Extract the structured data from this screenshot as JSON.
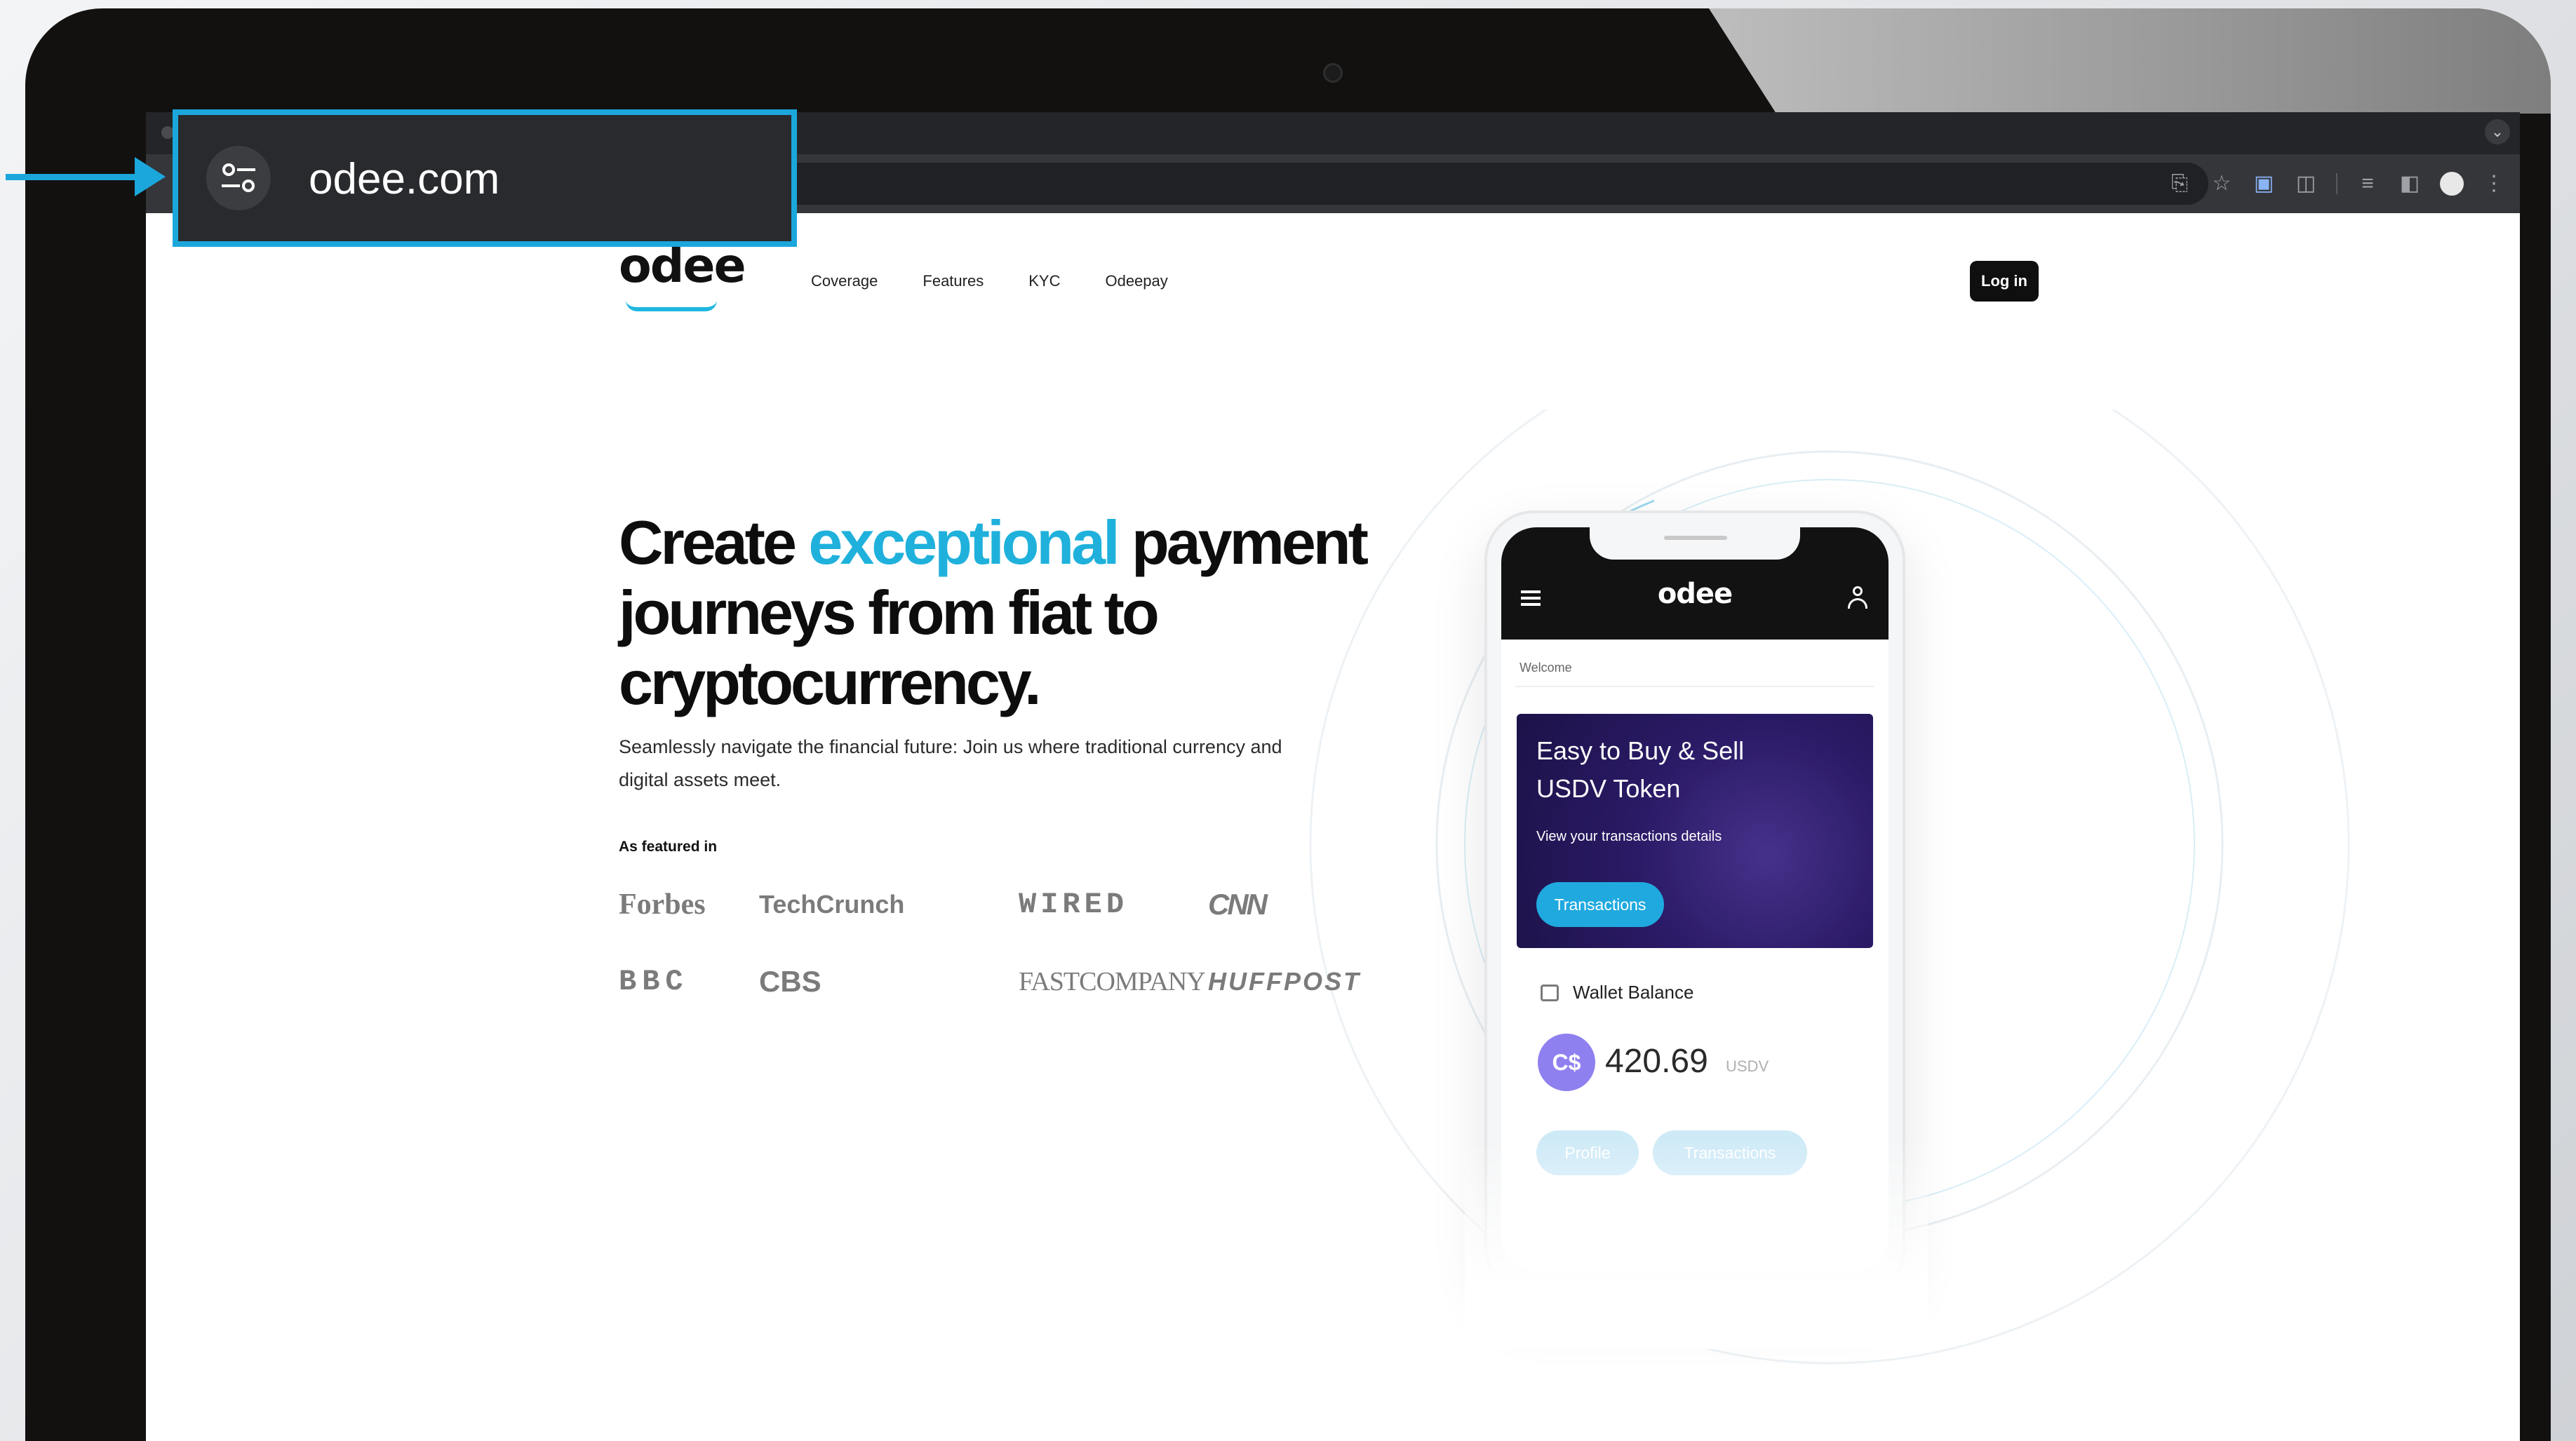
{
  "browser": {
    "url": "odee.com"
  },
  "site": {
    "logo": "odee",
    "nav": [
      "Coverage",
      "Features",
      "KYC",
      "Odeepay"
    ],
    "login_label": "Log in"
  },
  "hero": {
    "title_part1": "Create ",
    "title_accent": "exceptional",
    "title_part2": " payment journeys from fiat to cryptocurrency.",
    "subtitle": "Seamlessly navigate the financial future: Join us where traditional currency and digital assets meet."
  },
  "featured": {
    "label": "As featured in",
    "logos": [
      "Forbes",
      "TechCrunch",
      "WIRED",
      "CNN",
      "BBC",
      "CBS",
      "FASTCOMPANY",
      "HUFFPOST"
    ]
  },
  "phone_app": {
    "logo": "odee",
    "welcome": "Welcome",
    "promo_title": "Easy to Buy & Sell USDV Token",
    "promo_subtitle": "View your transactions details",
    "promo_button": "Transactions",
    "wallet_label": "Wallet Balance",
    "balance": "420.69",
    "balance_unit": "USDV",
    "profile_button": "Profile",
    "transactions_button": "Transactions"
  },
  "colors": {
    "accent": "#1fb1dc",
    "callout": "#1ba7dc",
    "promo_bg": "#2b1a66",
    "button_dark": "#0f0f10"
  }
}
